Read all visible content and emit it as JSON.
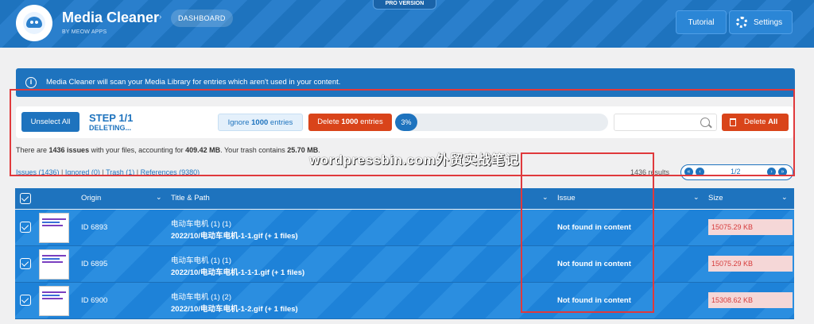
{
  "header": {
    "app_title": "Media Cleaner",
    "app_subtitle": "BY MEOW APPS",
    "breadcrumb": "DASHBOARD",
    "pro_badge": "PRO VERSION",
    "tutorial_label": "Tutorial",
    "settings_label": "Settings"
  },
  "info_message": "Media Cleaner will scan your Media Library for entries which aren't used in your content.",
  "actions": {
    "unselect_all": "Unselect All",
    "step_title": "STEP 1/1",
    "step_status": "DELETING...",
    "ignore_prefix": "Ignore ",
    "ignore_count": "1000",
    "ignore_suffix": " entries",
    "delete_prefix": "Delete ",
    "delete_count": "1000",
    "delete_suffix": " entries",
    "progress_label": "3%",
    "progress_value": 0.03,
    "search_placeholder": "",
    "delete_all_prefix": "Delete ",
    "delete_all_strong": "All"
  },
  "summary": {
    "p1": "There are ",
    "issues": "1436 issues",
    "p2": " with your files, accounting for ",
    "size": "409.42 MB",
    "p3": ". Your trash contains ",
    "trash": "25.70 MB",
    "p4": "."
  },
  "filters": {
    "issues": "Issues",
    "issues_count": " (1436)",
    "ignored": "Ignored",
    "ignored_count": " (0)",
    "trash": "Trash",
    "trash_count": " (1)",
    "references": "References",
    "references_count": " (9380)",
    "separator": " | "
  },
  "watermark": "wordpressbin.com外贸实战笔记",
  "results_text": "1436 results",
  "pager": {
    "first": "«",
    "prev": "‹",
    "page": "1/2",
    "next": "›",
    "last": "»"
  },
  "table": {
    "headers": {
      "origin": "Origin",
      "title_path": "Title & Path",
      "issue": "Issue",
      "size": "Size"
    },
    "rows": [
      {
        "id": "ID 6893",
        "title": "电动车电机 (1) (1)",
        "path": "2022/10/电动车电机-1-1.gif (+ 1 files)",
        "issue": "Not found in content",
        "size": "15075.29 KB"
      },
      {
        "id": "ID 6895",
        "title": "电动车电机 (1) (1)",
        "path": "2022/10/电动车电机-1-1-1.gif (+ 1 files)",
        "issue": "Not found in content",
        "size": "15075.29 KB"
      },
      {
        "id": "ID 6900",
        "title": "电动车电机 (1) (2)",
        "path": "2022/10/电动车电机-1-2.gif (+ 1 files)",
        "issue": "Not found in content",
        "size": "15308.62 KB"
      }
    ]
  },
  "colors": {
    "brand_blue": "#1e73be",
    "danger": "#d9441a",
    "annotation_red": "#e0393c"
  }
}
